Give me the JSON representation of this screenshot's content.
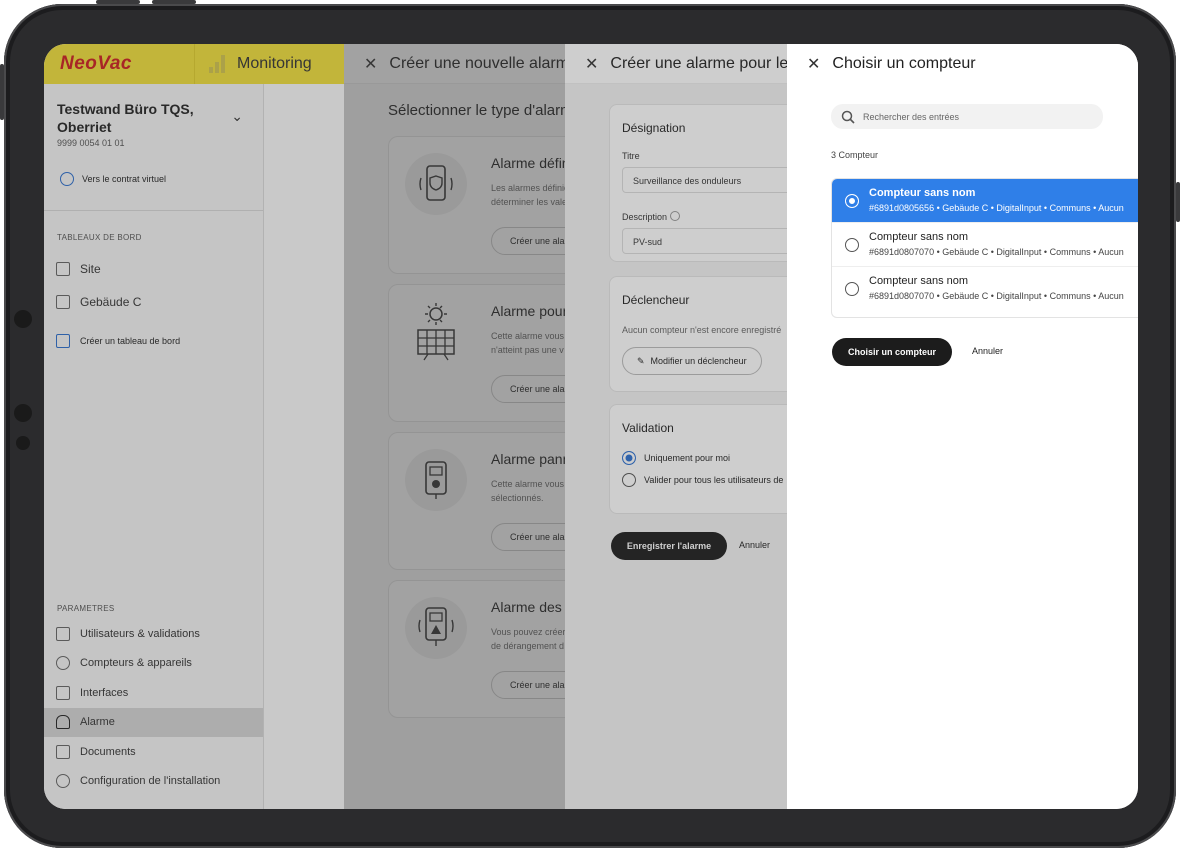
{
  "app": {
    "logo": "NeoVac",
    "module_tab": "Monitoring"
  },
  "sidebar": {
    "project_name": "Testwand Büro TQS, Oberriet",
    "project_number": "9999 0054 01 01",
    "virtual_contract_link": "Vers le contrat virtuel",
    "dashboards_heading": "TABLEAUX DE BORD",
    "dashboards": [
      "Site",
      "Gebäude C"
    ],
    "create_dashboard": "Créer un tableau de bord",
    "settings_heading": "PARAMETRES",
    "settings_items": [
      "Utilisateurs & validations",
      "Compteurs & appareils",
      "Interfaces",
      "Alarme",
      "Documents",
      "Configuration de l'installation"
    ]
  },
  "panel_new_alarm": {
    "title": "Créer une nouvelle alarme",
    "heading": "Sélectionner le type d'alarme",
    "cards": [
      {
        "title": "Alarme définie",
        "desc1": "Les alarmes définies",
        "desc2": "déterminer les valeurs",
        "button": "Créer une alarme"
      },
      {
        "title": "Alarme pour",
        "desc1": "Cette alarme vous",
        "desc2": "n'atteint pas une v",
        "button": "Créer une alarme"
      },
      {
        "title": "Alarme panne",
        "desc1": "Cette alarme vous",
        "desc2": "sélectionnés.",
        "button": "Créer une alarme"
      },
      {
        "title": "Alarme des",
        "desc1": "Vous pouvez créer",
        "desc2": "de dérangement d",
        "button": "Créer une alarme"
      }
    ]
  },
  "panel_alarm_form": {
    "title": "Créer une alarme pour les onduleurs",
    "designation": {
      "heading": "Désignation",
      "title_label": "Titre",
      "title_value": "Surveillance des onduleurs",
      "description_label": "Description",
      "description_value": "PV-sud"
    },
    "trigger": {
      "heading": "Déclencheur",
      "text": "Aucun compteur n'est encore enregistré",
      "button": "Modifier un déclencheur"
    },
    "validation": {
      "heading": "Validation",
      "options": [
        "Uniquement pour moi",
        "Valider pour tous les utilisateurs de"
      ]
    },
    "save_button": "Enregistrer l'alarme",
    "cancel_button": "Annuler"
  },
  "panel_choose_meter": {
    "title": "Choisir un compteur",
    "search_placeholder": "Rechercher des entrées",
    "count_text": "3 Compteur",
    "meters": [
      {
        "name": "Compteur sans nom",
        "details": "#6891d0805656 • Gebäude C • DigitalInput • Communs • Aucun",
        "selected": true
      },
      {
        "name": "Compteur sans nom",
        "details": "#6891d0807070 • Gebäude C • DigitalInput • Communs • Aucun",
        "selected": false
      },
      {
        "name": "Compteur sans nom",
        "details": "#6891d0807070 • Gebäude C • DigitalInput • Communs • Aucun",
        "selected": false
      }
    ],
    "choose_button": "Choisir un compteur",
    "cancel_button": "Annuler"
  },
  "colors": {
    "brand_yellow": "#f6e43a",
    "brand_red": "#d11e1e",
    "selection_blue": "#2f7fe8",
    "primary_dark": "#1c1c1c"
  }
}
